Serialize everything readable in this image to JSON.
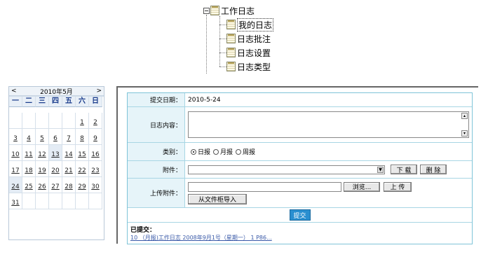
{
  "tree": {
    "root": "工作日志",
    "children": [
      "我的日志",
      "日志批注",
      "日志设置",
      "日志类型"
    ],
    "selected_index": 0
  },
  "calendar": {
    "prev": "<",
    "title": "2010年5月",
    "next": ">",
    "weekdays": [
      "一",
      "二",
      "三",
      "四",
      "五",
      "六",
      "日"
    ],
    "days": [
      "",
      "",
      "",
      "",
      "",
      "1",
      "2",
      "3",
      "4",
      "5",
      "6",
      "7",
      "8",
      "9",
      "10",
      "11",
      "12",
      "13",
      "14",
      "15",
      "16",
      "17",
      "18",
      "19",
      "20",
      "21",
      "22",
      "23",
      "24",
      "25",
      "26",
      "27",
      "28",
      "29",
      "30",
      "31",
      "",
      "",
      "",
      "",
      "",
      ""
    ],
    "highlighted": [
      "13",
      "24"
    ]
  },
  "form": {
    "submit_date_label": "提交日期：",
    "submit_date_value": "2010-5-24",
    "content_label": "日志内容：",
    "category_label": "类别：",
    "categories": [
      "日报",
      "月报",
      "周报"
    ],
    "selected_category": "日报",
    "attachment_label": "附件：",
    "download_button": "下 载",
    "delete_button": "删 除",
    "upload_label": "上传附件：",
    "browse_button": "浏览...",
    "upload_button": "上 传",
    "import_button": "从文件柜导入",
    "submit_button": "提交",
    "submitted_title": "已提交：",
    "submitted_entry": "10 （月报)工作日志 2008年9月1号（星期一） 1   P86..."
  }
}
